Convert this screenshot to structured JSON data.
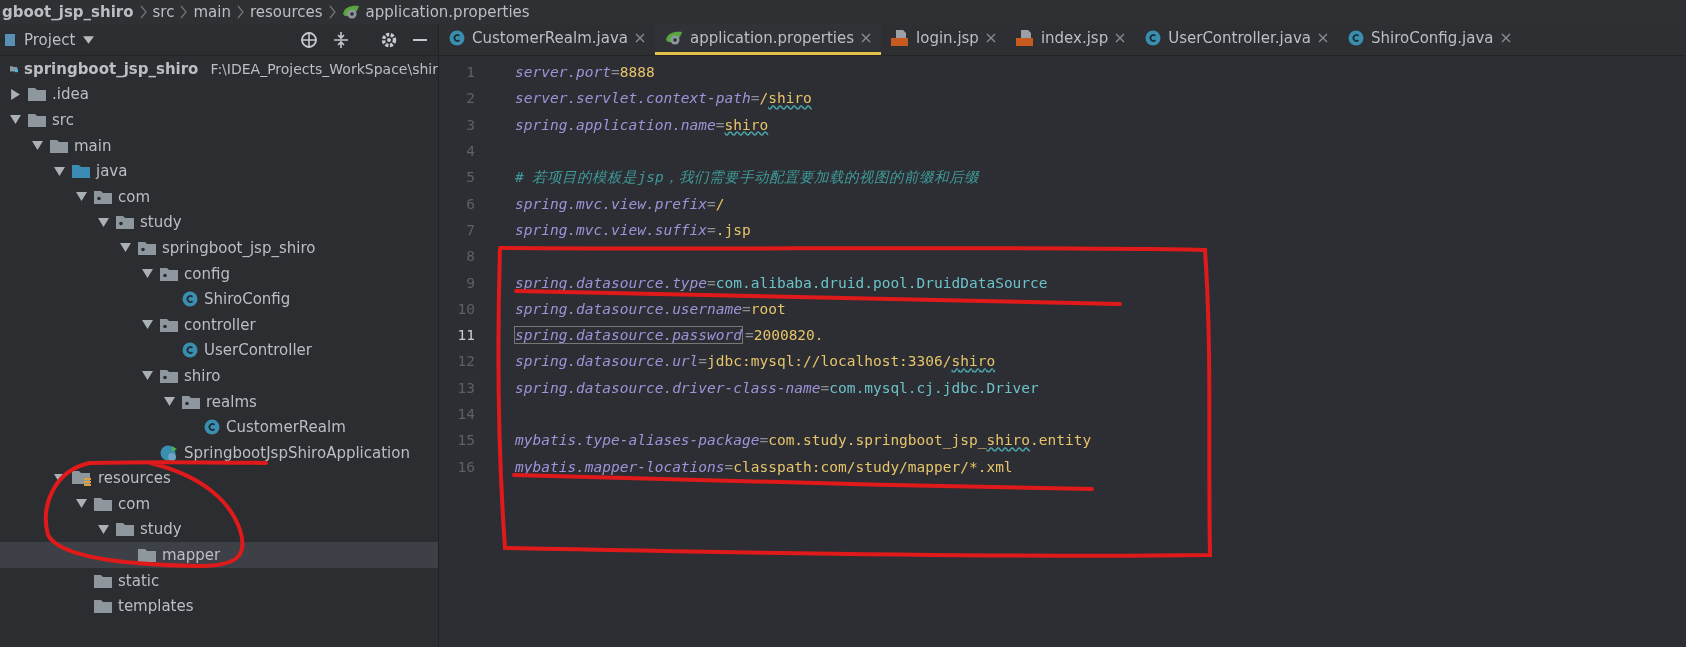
{
  "breadcrumb": [
    {
      "label": "gboot_jsp_shiro",
      "kind": "plain"
    },
    {
      "label": "src",
      "kind": "plain"
    },
    {
      "label": "main",
      "kind": "plain"
    },
    {
      "label": "resources",
      "kind": "plain"
    },
    {
      "label": "application.properties",
      "kind": "properties"
    }
  ],
  "project_panel": {
    "title": "Project",
    "root": {
      "label": "springboot_jsp_shiro",
      "path": "F:\\IDEA_Projects_WorkSpace\\shir",
      "kind": "project",
      "children": [
        {
          "label": ".idea",
          "kind": "folder",
          "expanded": false,
          "selected": false
        },
        {
          "label": "src",
          "kind": "folder",
          "expanded": true,
          "selected": false,
          "children": [
            {
              "label": "main",
              "kind": "folder",
              "expanded": true,
              "selected": false,
              "children": [
                {
                  "label": "java",
                  "kind": "source",
                  "expanded": true,
                  "selected": false,
                  "children": [
                    {
                      "label": "com",
                      "kind": "package",
                      "expanded": true,
                      "selected": false,
                      "children": [
                        {
                          "label": "study",
                          "kind": "package",
                          "expanded": true,
                          "selected": false,
                          "children": [
                            {
                              "label": "springboot_jsp_shiro",
                              "kind": "package",
                              "expanded": true,
                              "selected": false,
                              "children": [
                                {
                                  "label": "config",
                                  "kind": "package",
                                  "expanded": true,
                                  "selected": false,
                                  "children": [
                                    {
                                      "label": "ShiroConfig",
                                      "kind": "class",
                                      "selected": false
                                    }
                                  ]
                                },
                                {
                                  "label": "controller",
                                  "kind": "package",
                                  "expanded": true,
                                  "selected": false,
                                  "children": [
                                    {
                                      "label": "UserController",
                                      "kind": "class",
                                      "selected": false
                                    }
                                  ]
                                },
                                {
                                  "label": "shiro",
                                  "kind": "package",
                                  "expanded": true,
                                  "selected": false,
                                  "children": [
                                    {
                                      "label": "realms",
                                      "kind": "package",
                                      "expanded": true,
                                      "selected": false,
                                      "children": [
                                        {
                                          "label": "CustomerRealm",
                                          "kind": "class",
                                          "selected": false
                                        }
                                      ]
                                    }
                                  ]
                                },
                                {
                                  "label": "SpringbootJspShiroApplication",
                                  "kind": "app",
                                  "selected": false
                                }
                              ]
                            }
                          ]
                        }
                      ]
                    }
                  ]
                },
                {
                  "label": "resources",
                  "kind": "resources",
                  "expanded": true,
                  "selected": false,
                  "children": [
                    {
                      "label": "com",
                      "kind": "folder",
                      "expanded": true,
                      "selected": false,
                      "children": [
                        {
                          "label": "study",
                          "kind": "folder",
                          "expanded": true,
                          "selected": false,
                          "children": [
                            {
                              "label": "mapper",
                              "kind": "folder",
                              "selected": true
                            }
                          ]
                        }
                      ]
                    },
                    {
                      "label": "static",
                      "kind": "folder",
                      "selected": false
                    },
                    {
                      "label": "templates",
                      "kind": "folder",
                      "selected": false
                    }
                  ]
                }
              ]
            }
          ]
        }
      ]
    }
  },
  "tabs": [
    {
      "label": "CustomerRealm.java",
      "kind": "class",
      "selected": false
    },
    {
      "label": "application.properties",
      "kind": "properties",
      "selected": true
    },
    {
      "label": "login.jsp",
      "kind": "jsp",
      "selected": false
    },
    {
      "label": "index.jsp",
      "kind": "jsp",
      "selected": false
    },
    {
      "label": "UserController.java",
      "kind": "class",
      "selected": false
    },
    {
      "label": "ShiroConfig.java",
      "kind": "class",
      "selected": false
    }
  ],
  "editor": {
    "lines": [
      {
        "number": "1",
        "kind": "property",
        "tokens": [
          {
            "text": "server.port",
            "kind": "key"
          },
          {
            "text": "=",
            "kind": "sign"
          },
          {
            "text": "8888",
            "kind": "value"
          }
        ],
        "current": false
      },
      {
        "number": "2",
        "kind": "property",
        "tokens": [
          {
            "text": "server.servlet.context-path",
            "kind": "key"
          },
          {
            "text": "=",
            "kind": "sign"
          },
          {
            "text": "/",
            "kind": "value"
          },
          {
            "text": "shiro",
            "kind": "value-typo"
          }
        ],
        "current": false
      },
      {
        "number": "3",
        "kind": "property",
        "tokens": [
          {
            "text": "spring.application.name",
            "kind": "key"
          },
          {
            "text": "=",
            "kind": "sign"
          },
          {
            "text": "shiro",
            "kind": "value-typo"
          }
        ],
        "current": false
      },
      {
        "number": "4",
        "kind": "blank",
        "current": false
      },
      {
        "number": "5",
        "kind": "comment",
        "text": "# 若项目的模板是jsp，我们需要手动配置要加载的视图的前缀和后缀",
        "current": false
      },
      {
        "number": "6",
        "kind": "property",
        "tokens": [
          {
            "text": "spring.mvc.view.prefix",
            "kind": "key"
          },
          {
            "text": "=",
            "kind": "sign"
          },
          {
            "text": "/",
            "kind": "value"
          }
        ],
        "current": false
      },
      {
        "number": "7",
        "kind": "property",
        "tokens": [
          {
            "text": "spring.mvc.view.suffix",
            "kind": "key"
          },
          {
            "text": "=",
            "kind": "sign"
          },
          {
            "text": ".jsp",
            "kind": "value"
          }
        ],
        "current": false
      },
      {
        "number": "8",
        "kind": "blank",
        "current": false
      },
      {
        "number": "9",
        "kind": "property",
        "tokens": [
          {
            "text": "spring.datasource.type",
            "kind": "key"
          },
          {
            "text": "=",
            "kind": "sign"
          },
          {
            "text": "com.alibaba.druid.pool.DruidDataSource",
            "kind": "class"
          }
        ],
        "current": false
      },
      {
        "number": "10",
        "kind": "property",
        "tokens": [
          {
            "text": "spring.datasource.username",
            "kind": "key"
          },
          {
            "text": "=",
            "kind": "sign"
          },
          {
            "text": "root",
            "kind": "value"
          }
        ],
        "current": false
      },
      {
        "number": "11",
        "kind": "property",
        "tokens": [
          {
            "text": "spring.datasource.password",
            "kind": "key"
          },
          {
            "text": "=",
            "kind": "sign"
          },
          {
            "text": "2000820.",
            "kind": "value"
          }
        ],
        "current": true
      },
      {
        "number": "12",
        "kind": "property",
        "tokens": [
          {
            "text": "spring.datasource.url",
            "kind": "key"
          },
          {
            "text": "=",
            "kind": "sign"
          },
          {
            "text": "jdbc:mysql://localhost:3306/",
            "kind": "value"
          },
          {
            "text": "shiro",
            "kind": "value-typo"
          }
        ],
        "current": false
      },
      {
        "number": "13",
        "kind": "property",
        "tokens": [
          {
            "text": "spring.datasource.driver-class-name",
            "kind": "key"
          },
          {
            "text": "=",
            "kind": "sign"
          },
          {
            "text": "com.mysql.cj.jdbc.Driver",
            "kind": "class"
          }
        ],
        "current": false
      },
      {
        "number": "14",
        "kind": "blank",
        "current": false
      },
      {
        "number": "15",
        "kind": "property",
        "tokens": [
          {
            "text": "mybatis.type-aliases-package",
            "kind": "key"
          },
          {
            "text": "=",
            "kind": "sign"
          },
          {
            "text": "com.study.springboot_jsp_",
            "kind": "value"
          },
          {
            "text": "shiro",
            "kind": "value-typo"
          },
          {
            "text": ".entity",
            "kind": "value"
          }
        ],
        "current": false
      },
      {
        "number": "16",
        "kind": "property",
        "tokens": [
          {
            "text": "mybatis.mapper-locations",
            "kind": "key"
          },
          {
            "text": "=",
            "kind": "sign"
          },
          {
            "text": "classpath:com/study/mapper/*.xml",
            "kind": "value"
          }
        ],
        "current": false
      }
    ]
  },
  "annotations": [
    {
      "kind": "loop"
    },
    {
      "kind": "box"
    },
    {
      "kind": "underline"
    },
    {
      "kind": "underline"
    }
  ]
}
